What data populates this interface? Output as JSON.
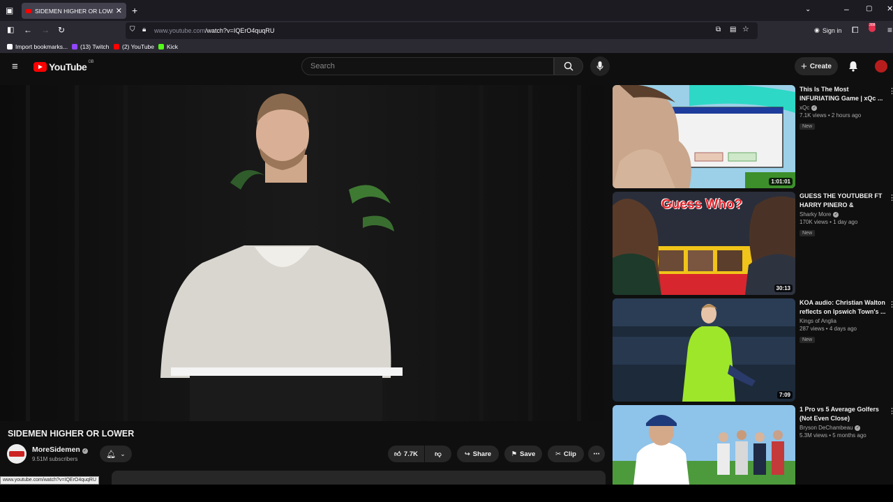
{
  "browser": {
    "tab_title": "SIDEMEN HIGHER OR LOWER -",
    "url_host": "www.youtube.com",
    "url_path": "/watch?v=IQErO4quqRU",
    "sign_in": "Sign in",
    "notification_count": "308",
    "bookmarks": [
      {
        "label": "Import bookmarks...",
        "color": "#fbfbfe"
      },
      {
        "label": "(13) Twitch",
        "color": "#9146ff"
      },
      {
        "label": "(2) YouTube",
        "color": "#ff0000"
      },
      {
        "label": "Kick",
        "color": "#53fc18"
      }
    ]
  },
  "youtube": {
    "logo_text": "YouTube",
    "region": "GB",
    "search_placeholder": "Search",
    "create_label": "Create"
  },
  "video": {
    "title": "SIDEMEN HIGHER OR LOWER",
    "channel": "MoreSidemen",
    "subscribers": "9.51M subscribers",
    "likes": "7.7K",
    "share_label": "Share",
    "save_label": "Save",
    "clip_label": "Clip"
  },
  "status_url": "www.youtube.com/watch?v=IQErO4quqRU",
  "recommendations": [
    {
      "title": "This Is The Most INFURIATING Game | xQc ...",
      "channel": "xQc",
      "stats": "7.1K views • 2 hours ago",
      "badge": "New",
      "duration": "1:01:01"
    },
    {
      "title": "GUESS THE YOUTUBER FT HARRY PINERO & DARKES...",
      "channel": "Sharky More",
      "stats": "170K views • 1 day ago",
      "badge": "New",
      "duration": "30:13",
      "thumb_text": "Guess Who?"
    },
    {
      "title": "KOA audio: Christian Walton reflects on Ipswich Town's ...",
      "channel": "Kings of Anglia",
      "stats": "287 views • 4 days ago",
      "badge": "New",
      "duration": "7:09"
    },
    {
      "title": "1 Pro vs 5 Average Golfers (Not Even Close)",
      "channel": "Bryson DeChambeau",
      "stats": "5.3M views • 5 months ago",
      "badge": "",
      "duration": ""
    }
  ],
  "colors": {
    "youtube_red": "#ff0000",
    "page_bg": "#0f0f0f",
    "chip_bg": "#272727"
  }
}
